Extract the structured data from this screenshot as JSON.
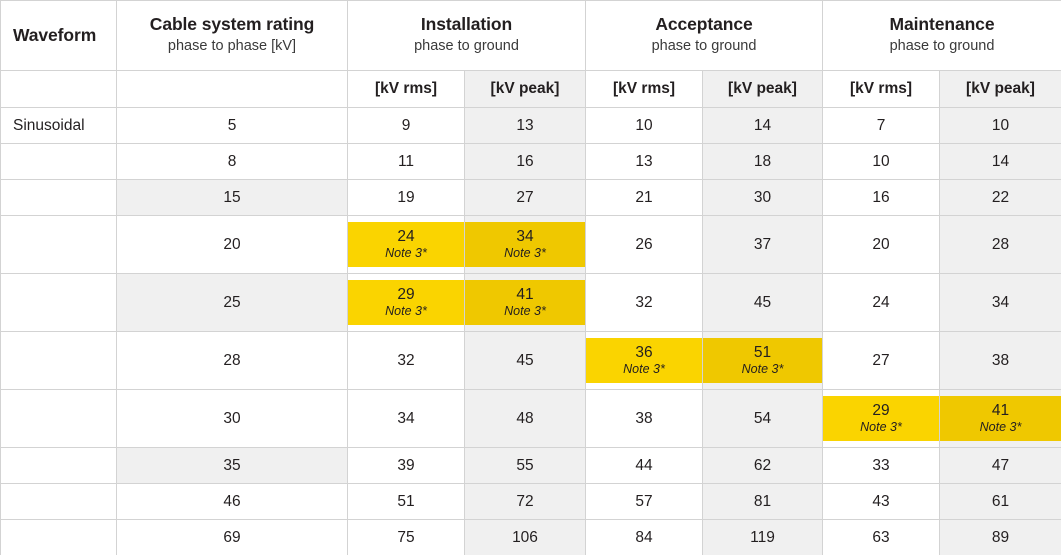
{
  "table": {
    "colors": {
      "highlight": "#FAD400",
      "highlight_striped": "#EFC800",
      "stripe": "#F0F0F0",
      "border": "#D3D3D3",
      "text": "#231F20"
    },
    "header_groups": [
      {
        "title": "Waveform",
        "subtitle": ""
      },
      {
        "title": "Cable system rating",
        "subtitle": "phase to phase [kV]"
      },
      {
        "title": "Installation",
        "subtitle": "phase to ground"
      },
      {
        "title": "Acceptance",
        "subtitle": "phase to ground"
      },
      {
        "title": "Maintenance",
        "subtitle": "phase to ground"
      }
    ],
    "unit_headers": [
      "",
      "",
      "[kV rms]",
      "[kV peak]",
      "[kV rms]",
      "[kV peak]",
      "[kV rms]",
      "[kV peak]"
    ],
    "note_label": "Note 3*",
    "rows": [
      {
        "waveform": "Sinusoidal",
        "rating": "5",
        "cells": [
          {
            "value": "9",
            "note": ""
          },
          {
            "value": "13",
            "note": ""
          },
          {
            "value": "10",
            "note": ""
          },
          {
            "value": "14",
            "note": ""
          },
          {
            "value": "7",
            "note": ""
          },
          {
            "value": "10",
            "note": ""
          }
        ]
      },
      {
        "waveform": "",
        "rating": "8",
        "cells": [
          {
            "value": "11",
            "note": ""
          },
          {
            "value": "16",
            "note": ""
          },
          {
            "value": "13",
            "note": ""
          },
          {
            "value": "18",
            "note": ""
          },
          {
            "value": "10",
            "note": ""
          },
          {
            "value": "14",
            "note": ""
          }
        ]
      },
      {
        "waveform": "",
        "rating": "15",
        "cells": [
          {
            "value": "19",
            "note": ""
          },
          {
            "value": "27",
            "note": ""
          },
          {
            "value": "21",
            "note": ""
          },
          {
            "value": "30",
            "note": ""
          },
          {
            "value": "16",
            "note": ""
          },
          {
            "value": "22",
            "note": ""
          }
        ]
      },
      {
        "waveform": "",
        "rating": "20",
        "cells": [
          {
            "value": "24",
            "note": "Note 3*"
          },
          {
            "value": "34",
            "note": "Note 3*"
          },
          {
            "value": "26",
            "note": ""
          },
          {
            "value": "37",
            "note": ""
          },
          {
            "value": "20",
            "note": ""
          },
          {
            "value": "28",
            "note": ""
          }
        ]
      },
      {
        "waveform": "",
        "rating": "25",
        "cells": [
          {
            "value": "29",
            "note": "Note 3*"
          },
          {
            "value": "41",
            "note": "Note 3*"
          },
          {
            "value": "32",
            "note": ""
          },
          {
            "value": "45",
            "note": ""
          },
          {
            "value": "24",
            "note": ""
          },
          {
            "value": "34",
            "note": ""
          }
        ]
      },
      {
        "waveform": "",
        "rating": "28",
        "cells": [
          {
            "value": "32",
            "note": ""
          },
          {
            "value": "45",
            "note": ""
          },
          {
            "value": "36",
            "note": "Note 3*"
          },
          {
            "value": "51",
            "note": "Note 3*"
          },
          {
            "value": "27",
            "note": ""
          },
          {
            "value": "38",
            "note": ""
          }
        ]
      },
      {
        "waveform": "",
        "rating": "30",
        "cells": [
          {
            "value": "34",
            "note": ""
          },
          {
            "value": "48",
            "note": ""
          },
          {
            "value": "38",
            "note": ""
          },
          {
            "value": "54",
            "note": ""
          },
          {
            "value": "29",
            "note": "Note 3*"
          },
          {
            "value": "41",
            "note": "Note 3*"
          }
        ]
      },
      {
        "waveform": "",
        "rating": "35",
        "cells": [
          {
            "value": "39",
            "note": ""
          },
          {
            "value": "55",
            "note": ""
          },
          {
            "value": "44",
            "note": ""
          },
          {
            "value": "62",
            "note": ""
          },
          {
            "value": "33",
            "note": ""
          },
          {
            "value": "47",
            "note": ""
          }
        ]
      },
      {
        "waveform": "",
        "rating": "46",
        "cells": [
          {
            "value": "51",
            "note": ""
          },
          {
            "value": "72",
            "note": ""
          },
          {
            "value": "57",
            "note": ""
          },
          {
            "value": "81",
            "note": ""
          },
          {
            "value": "43",
            "note": ""
          },
          {
            "value": "61",
            "note": ""
          }
        ]
      },
      {
        "waveform": "",
        "rating": "69",
        "cells": [
          {
            "value": "75",
            "note": ""
          },
          {
            "value": "106",
            "note": ""
          },
          {
            "value": "84",
            "note": ""
          },
          {
            "value": "119",
            "note": ""
          },
          {
            "value": "63",
            "note": ""
          },
          {
            "value": "89",
            "note": ""
          }
        ]
      }
    ]
  }
}
